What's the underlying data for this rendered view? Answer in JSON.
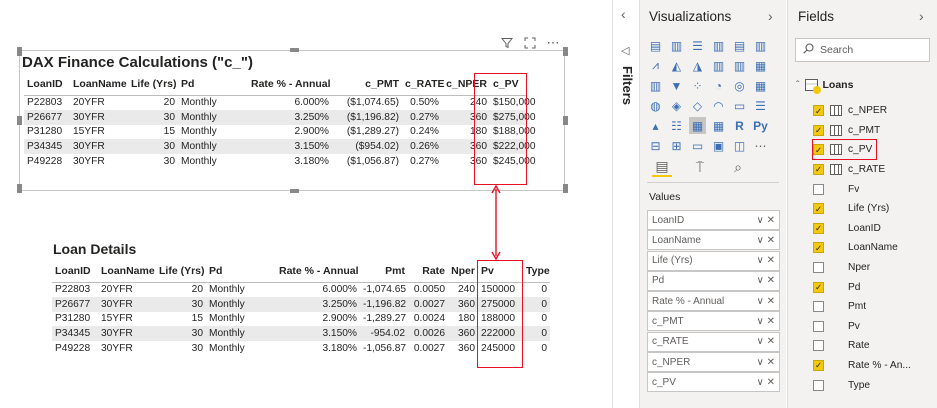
{
  "visual1": {
    "title": "DAX Finance Calculations (\"c_\")",
    "columns": [
      "LoanID",
      "LoanName",
      "Life (Yrs)",
      "Pd",
      "Rate % - Annual",
      "c_PMT",
      "c_RATE",
      "c_NPER",
      "c_PV"
    ],
    "rows": [
      [
        "P22803",
        "20YFR",
        "20",
        "Monthly",
        "6.000%",
        "($1,074.65)",
        "0.50%",
        "240",
        "$150,000"
      ],
      [
        "P26677",
        "30YFR",
        "30",
        "Monthly",
        "3.250%",
        "($1,196.82)",
        "0.27%",
        "360",
        "$275,000"
      ],
      [
        "P31280",
        "15YFR",
        "15",
        "Monthly",
        "2.900%",
        "($1,289.27)",
        "0.24%",
        "180",
        "$188,000"
      ],
      [
        "P34345",
        "30YFR",
        "30",
        "Monthly",
        "3.150%",
        "($954.02)",
        "0.26%",
        "360",
        "$222,000"
      ],
      [
        "P49228",
        "30YFR",
        "30",
        "Monthly",
        "3.180%",
        "($1,056.87)",
        "0.27%",
        "360",
        "$245,000"
      ]
    ]
  },
  "visual2": {
    "title": "Loan Details",
    "columns": [
      "LoanID",
      "LoanName",
      "Life (Yrs)",
      "Pd",
      "Rate % - Annual",
      "Pmt",
      "Rate",
      "Nper",
      "Pv",
      "Type"
    ],
    "rows": [
      [
        "P22803",
        "20YFR",
        "20",
        "Monthly",
        "6.000%",
        "-1,074.65",
        "0.0050",
        "240",
        "150000",
        "0"
      ],
      [
        "P26677",
        "30YFR",
        "30",
        "Monthly",
        "3.250%",
        "-1,196.82",
        "0.0027",
        "360",
        "275000",
        "0"
      ],
      [
        "P31280",
        "15YFR",
        "15",
        "Monthly",
        "2.900%",
        "-1,289.27",
        "0.0024",
        "180",
        "188000",
        "0"
      ],
      [
        "P34345",
        "30YFR",
        "30",
        "Monthly",
        "3.150%",
        "-954.02",
        "0.0026",
        "360",
        "222000",
        "0"
      ],
      [
        "P49228",
        "30YFR",
        "30",
        "Monthly",
        "3.180%",
        "-1,056.87",
        "0.0027",
        "360",
        "245000",
        "0"
      ]
    ]
  },
  "filters": {
    "label": "Filters",
    "collapse_glyph": "‹"
  },
  "visualizations": {
    "title": "Visualizations",
    "expand_glyph": "›",
    "values_label": "Values",
    "wells": [
      "LoanID",
      "LoanName",
      "Life (Yrs)",
      "Pd",
      "Rate % - Annual",
      "c_PMT",
      "c_RATE",
      "c_NPER",
      "c_PV"
    ],
    "well_controls": "∨ ✕"
  },
  "fields": {
    "title": "Fields",
    "expand_glyph": "›",
    "search_placeholder": "Search",
    "table_name": "Loans",
    "items": [
      {
        "name": "c_NPER",
        "checked": true,
        "calc": true
      },
      {
        "name": "c_PMT",
        "checked": true,
        "calc": true
      },
      {
        "name": "c_PV",
        "checked": true,
        "calc": true
      },
      {
        "name": "c_RATE",
        "checked": true,
        "calc": true
      },
      {
        "name": "Fv",
        "checked": false,
        "calc": false
      },
      {
        "name": "Life (Yrs)",
        "checked": true,
        "calc": false
      },
      {
        "name": "LoanID",
        "checked": true,
        "calc": false
      },
      {
        "name": "LoanName",
        "checked": true,
        "calc": false
      },
      {
        "name": "Nper",
        "checked": false,
        "calc": false
      },
      {
        "name": "Pd",
        "checked": true,
        "calc": false
      },
      {
        "name": "Pmt",
        "checked": false,
        "calc": false
      },
      {
        "name": "Pv",
        "checked": false,
        "calc": false
      },
      {
        "name": "Rate",
        "checked": false,
        "calc": false
      },
      {
        "name": "Rate % - An...",
        "checked": true,
        "calc": false
      },
      {
        "name": "Type",
        "checked": false,
        "calc": false
      }
    ]
  },
  "colors": {
    "highlight": "#e81123",
    "accent": "#f2c811",
    "pane_bg": "#f3f2f1",
    "row_alt": "#eaeaea"
  }
}
